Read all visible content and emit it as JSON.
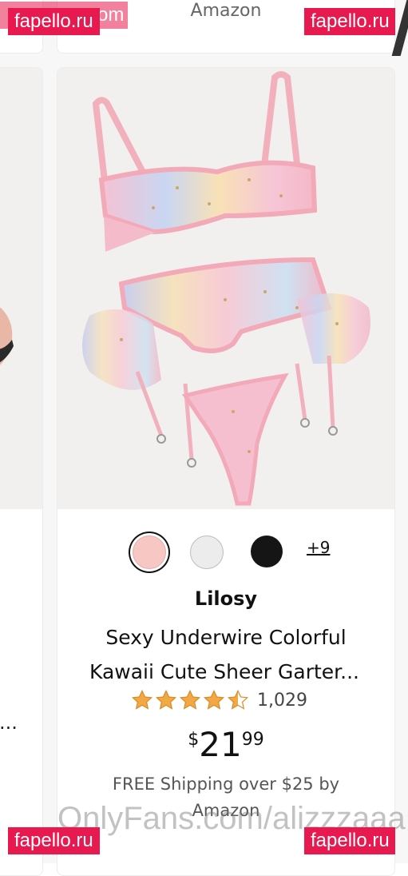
{
  "top": {
    "seller_text": "Amazon"
  },
  "product": {
    "brand": "Lilosy",
    "title_line1": "Sexy Underwire Colorful",
    "title_line2": "Kawaii Cute Sheer Garter...",
    "rating_value": 4.5,
    "rating_count": "1,029",
    "price_symbol": "$",
    "price_whole": "21",
    "price_fraction": "99",
    "shipping_line1": "FREE Shipping over $25 by",
    "shipping_line2": "Amazon",
    "swatches": [
      {
        "name": "pink",
        "color": "#f6c7c3",
        "selected": true
      },
      {
        "name": "white",
        "color": "#ececec",
        "selected": false
      },
      {
        "name": "black",
        "color": "#151515",
        "selected": false
      }
    ],
    "more_colors": "+9"
  },
  "left_card": {
    "ellipsis": "..."
  },
  "watermarks": {
    "site": "fapello.ru",
    "top_left": "fapello.ru",
    "top_left_partial": "om",
    "onlyfans": "OnlyFans.com/alizzzaaa"
  },
  "colors": {
    "star": "#f3a847",
    "watermark_bg": "#e8194e",
    "bra_pink": "#f4b6c2"
  }
}
